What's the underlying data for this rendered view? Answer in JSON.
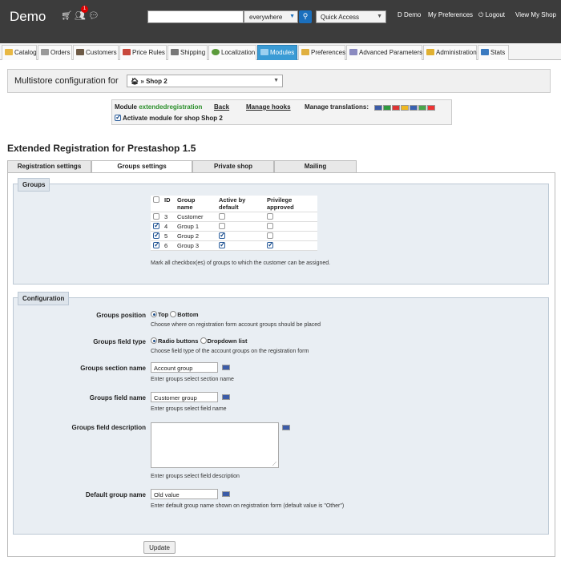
{
  "header": {
    "shop_name": "Demo",
    "notifications_count": "1",
    "search_value": "",
    "search_scope": "everywhere",
    "quick_access": "Quick Access",
    "employee": "D Demo",
    "my_preferences": "My Preferences",
    "logout": "Logout",
    "view_shop": "View My Shop"
  },
  "tabs": [
    {
      "label": "Catalog"
    },
    {
      "label": "Orders"
    },
    {
      "label": "Customers"
    },
    {
      "label": "Price Rules"
    },
    {
      "label": "Shipping"
    },
    {
      "label": "Localization"
    },
    {
      "label": "Modules"
    },
    {
      "label": "Preferences"
    },
    {
      "label": "Advanced Parameters"
    },
    {
      "label": "Administration"
    },
    {
      "label": "Stats"
    }
  ],
  "multistore": {
    "label": "Multistore configuration for",
    "selected": "» Shop 2"
  },
  "module_bar": {
    "module_prefix": "Module",
    "module_name": "extendedregistration",
    "back": "Back",
    "manage_hooks": "Manage hooks",
    "manage_translations": "Manage translations:",
    "activate_label": "Activate module for shop Shop 2"
  },
  "page_title": "Extended Registration for Prestashop 1.5",
  "content_tabs": [
    {
      "label": "Registration settings"
    },
    {
      "label": "Groups settings"
    },
    {
      "label": "Private shop"
    },
    {
      "label": "Mailing"
    }
  ],
  "groups": {
    "legend": "Groups",
    "columns": [
      "ID",
      "Group name",
      "Active by default",
      "Privilege approved"
    ],
    "column_lines": {
      "name": [
        "Group",
        "name"
      ],
      "active": [
        "Active by",
        "default"
      ],
      "privilege": [
        "Privilege",
        "approved"
      ]
    },
    "rows": [
      {
        "id": "3",
        "name": "Customer",
        "selected": false,
        "active": false,
        "privilege": false
      },
      {
        "id": "4",
        "name": "Group 1",
        "selected": true,
        "active": false,
        "privilege": false
      },
      {
        "id": "5",
        "name": "Group 2",
        "selected": true,
        "active": true,
        "privilege": false
      },
      {
        "id": "6",
        "name": "Group 3",
        "selected": true,
        "active": true,
        "privilege": true
      }
    ],
    "hint": "Mark all checkbox(es) of groups to which the customer can be assigned."
  },
  "configuration": {
    "legend": "Configuration",
    "groups_position": {
      "label": "Groups position",
      "options": [
        "Top",
        "Bottom"
      ],
      "selected": "Top",
      "hint": "Choose where on registration form account groups should be placed"
    },
    "groups_field_type": {
      "label": "Groups field type",
      "options": [
        "Radio buttons",
        "Dropdown list"
      ],
      "selected": "Radio buttons",
      "hint": "Choose field type of the account groups on the registration form"
    },
    "section_name": {
      "label": "Groups section name",
      "value": "Account group",
      "hint": "Enter groups select section name"
    },
    "field_name": {
      "label": "Groups field name",
      "value": "Customer group",
      "hint": "Enter groups select field name"
    },
    "field_description": {
      "label": "Groups field description",
      "value": "",
      "hint": "Enter groups select field description"
    },
    "default_group_name": {
      "label": "Default group name",
      "value": "Old value",
      "hint": "Enter default group name shown on registration form (default value is \"Other\")"
    }
  },
  "update_button": "Update",
  "colors": {
    "header_bg": "#3c3c3c",
    "active_tab": "#3a9bd5",
    "fieldset_bg": "#e9eef3",
    "module_name_green": "#2b8f2b"
  }
}
